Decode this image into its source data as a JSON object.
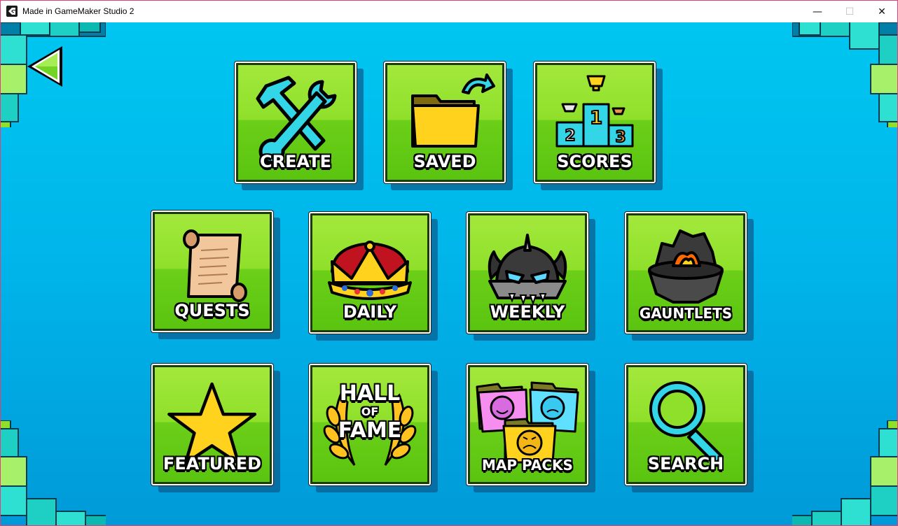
{
  "window": {
    "title": "Made in GameMaker Studio 2",
    "app_icon": "gamemaker-icon",
    "controls": {
      "minimize": "—",
      "maximize": "☐",
      "close": "✕"
    }
  },
  "menu": {
    "back_icon": "back-arrow-icon",
    "row1": [
      {
        "id": "create",
        "label": "Create",
        "icon": "hammer-wrench-icon"
      },
      {
        "id": "saved",
        "label": "Saved",
        "icon": "folder-icon"
      },
      {
        "id": "scores",
        "label": "Scores",
        "icon": "podium-icon",
        "podium": [
          "1",
          "2",
          "3"
        ]
      }
    ],
    "row2": [
      {
        "id": "quests",
        "label": "Quests",
        "icon": "scroll-icon"
      },
      {
        "id": "daily",
        "label": "Daily",
        "icon": "crown-icon"
      },
      {
        "id": "weekly",
        "label": "Weekly",
        "icon": "demon-icon"
      },
      {
        "id": "gauntlets",
        "label": "Gauntlets",
        "icon": "gauntlet-icon"
      }
    ],
    "row3": [
      {
        "id": "featured",
        "label": "Featured",
        "icon": "star-icon"
      },
      {
        "id": "hall-of-fame",
        "label_line1": "HALL",
        "label_line2": "OF",
        "label_line3": "FAME",
        "icon": "laurel-icon"
      },
      {
        "id": "map-packs",
        "label": "Map Packs",
        "icon": "map-packs-icon"
      },
      {
        "id": "search",
        "label": "Search",
        "icon": "magnifier-icon"
      }
    ]
  },
  "colors": {
    "sky": "#00b6ea",
    "tile_green": "#8fe02a",
    "corner_teal": "#1ad6c8"
  }
}
